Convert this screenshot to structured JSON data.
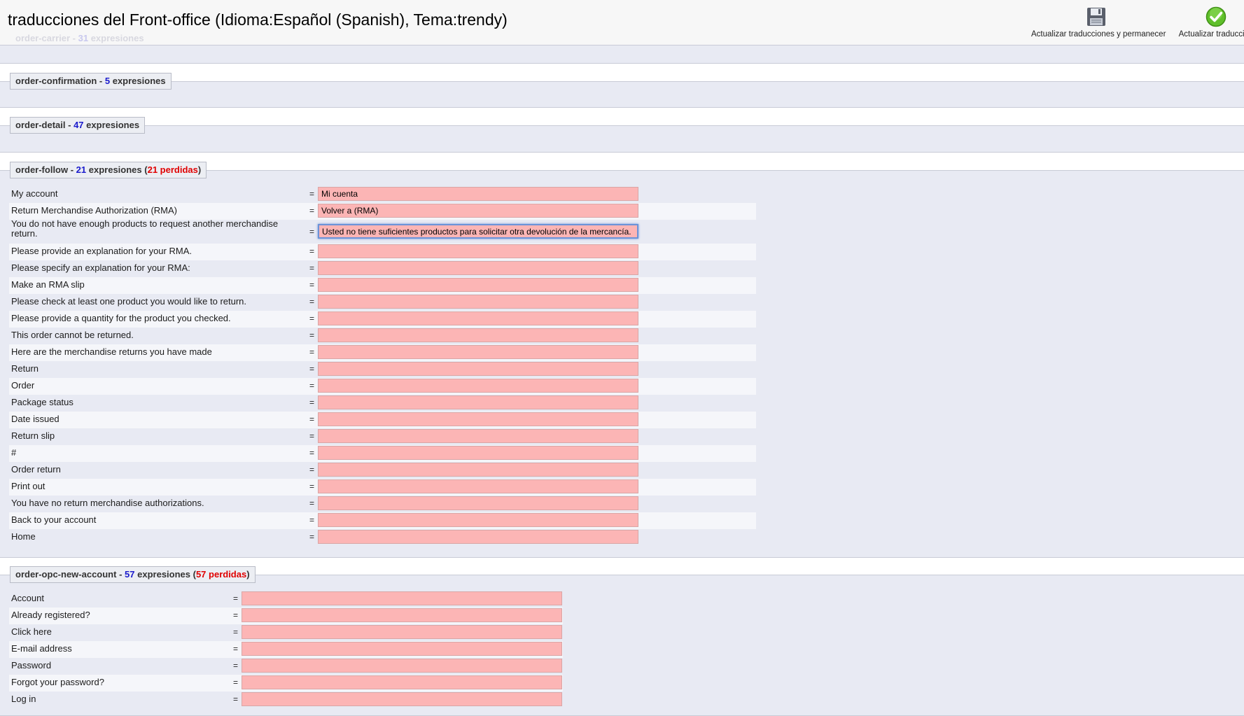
{
  "header": {
    "title": "traducciones del Front-office (Idioma:Español (Spanish), Tema:trendy)",
    "ghost_section": {
      "name": "order-carrier",
      "count": "31",
      "label": "expresiones"
    },
    "toolbar": {
      "stay_label": "Actualizar traducciones y permanecer",
      "update_label": "Actualizar traduccion"
    }
  },
  "sections": {
    "order_confirmation": {
      "name": "order-confirmation",
      "count": "5",
      "label": "expresiones"
    },
    "order_detail": {
      "name": "order-detail",
      "count": "47",
      "label": "expresiones"
    },
    "order_follow": {
      "name": "order-follow",
      "count": "21",
      "label": "expresiones",
      "lost": "21 perdidas",
      "rows": [
        {
          "source": "My account",
          "value": "Mi cuenta"
        },
        {
          "source": "Return Merchandise Authorization (RMA)",
          "value": "Volver a (RMA)"
        },
        {
          "source": "You do not have enough products to request another merchandise return.",
          "value": "Usted no tiene suficientes productos para solicitar otra devolución de la mercancía."
        },
        {
          "source": "Please provide an explanation for your RMA.",
          "value": ""
        },
        {
          "source": "Please specify an explanation for your RMA:",
          "value": ""
        },
        {
          "source": "Make an RMA slip",
          "value": ""
        },
        {
          "source": "Please check at least one product you would like to return.",
          "value": ""
        },
        {
          "source": "Please provide a quantity for the product you checked.",
          "value": ""
        },
        {
          "source": "This order cannot be returned.",
          "value": ""
        },
        {
          "source": "Here are the merchandise returns you have made",
          "value": ""
        },
        {
          "source": "Return",
          "value": ""
        },
        {
          "source": "Order",
          "value": ""
        },
        {
          "source": "Package status",
          "value": ""
        },
        {
          "source": "Date issued",
          "value": ""
        },
        {
          "source": "Return slip",
          "value": ""
        },
        {
          "source": "#",
          "value": ""
        },
        {
          "source": "Order return",
          "value": ""
        },
        {
          "source": "Print out",
          "value": ""
        },
        {
          "source": "You have no return merchandise authorizations.",
          "value": ""
        },
        {
          "source": "Back to your account",
          "value": ""
        },
        {
          "source": "Home",
          "value": ""
        }
      ]
    },
    "order_opc_new_account": {
      "name": "order-opc-new-account",
      "count": "57",
      "label": "expresiones",
      "lost": "57 perdidas",
      "rows": [
        {
          "source": "Account",
          "value": ""
        },
        {
          "source": "Already registered?",
          "value": ""
        },
        {
          "source": "Click here",
          "value": ""
        },
        {
          "source": "E-mail address",
          "value": ""
        },
        {
          "source": "Password",
          "value": ""
        },
        {
          "source": "Forgot your password?",
          "value": ""
        },
        {
          "source": "Log in",
          "value": ""
        }
      ]
    }
  },
  "separator": "="
}
